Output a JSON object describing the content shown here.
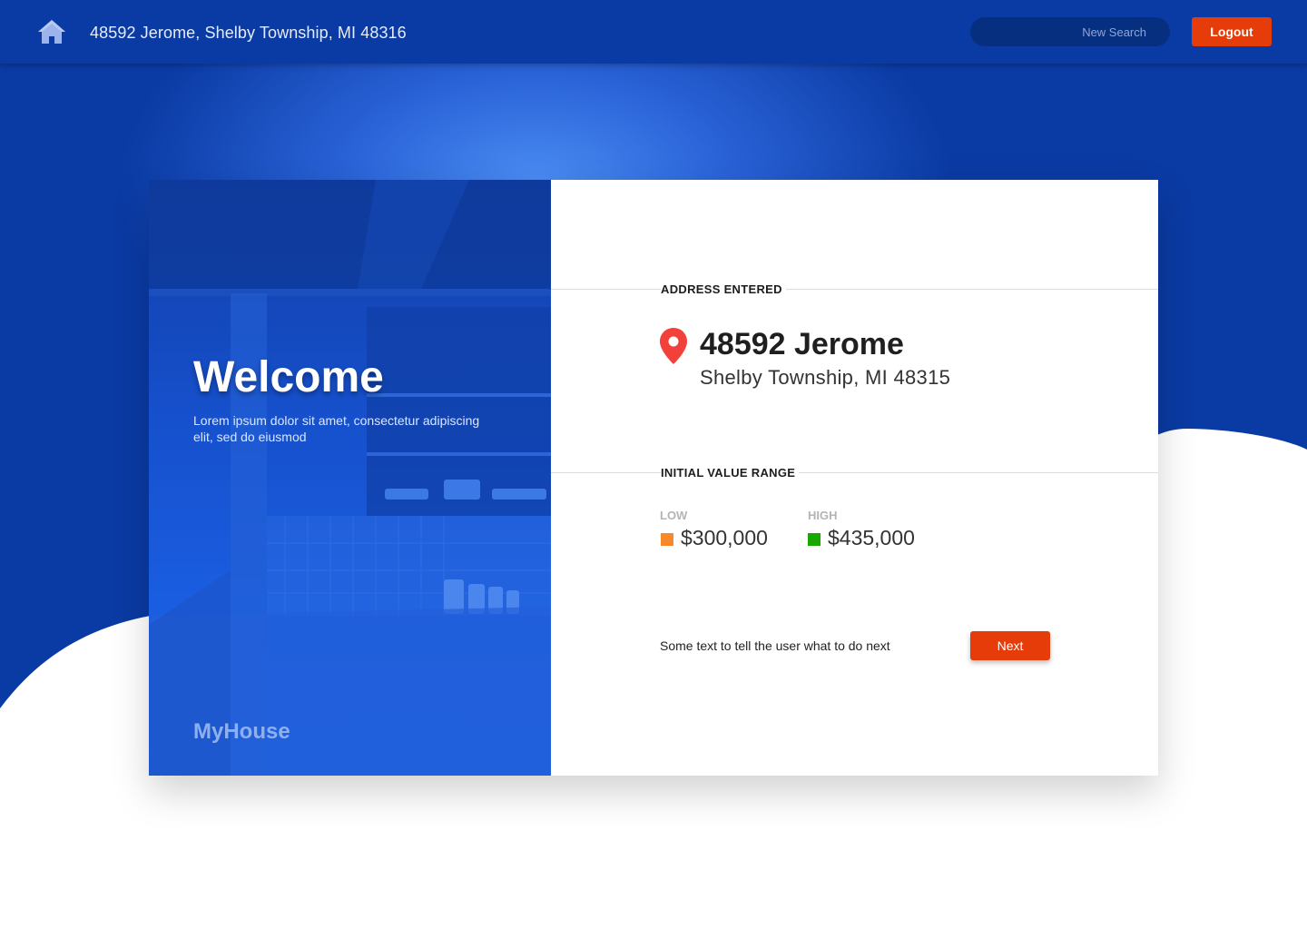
{
  "header": {
    "address": "48592 Jerome, Shelby Township, MI 48316",
    "search_placeholder": "New Search",
    "logout_label": "Logout"
  },
  "welcome": {
    "title": "Welcome",
    "text": "Lorem ipsum dolor sit amet, consectetur adipiscing elit, sed do eiusmod",
    "brand": "MyHouse"
  },
  "address_section": {
    "label": "ADDRESS ENTERED",
    "street": "48592 Jerome",
    "city": "Shelby Township, MI 48315"
  },
  "value_range": {
    "label": "INITIAL VALUE RANGE",
    "low_label": "LOW",
    "low_value": "$300,000",
    "high_label": "HIGH",
    "high_value": "$435,000"
  },
  "next_step": {
    "hint": "Some text to tell the user what to do next",
    "button_label": "Next"
  },
  "colors": {
    "primary_blue": "#0a3aa3",
    "accent_orange_red": "#e63c0a",
    "low_swatch": "#f7892b",
    "high_swatch": "#1aa800"
  },
  "icons": {
    "home": "home-icon",
    "pin": "map-pin-icon"
  }
}
